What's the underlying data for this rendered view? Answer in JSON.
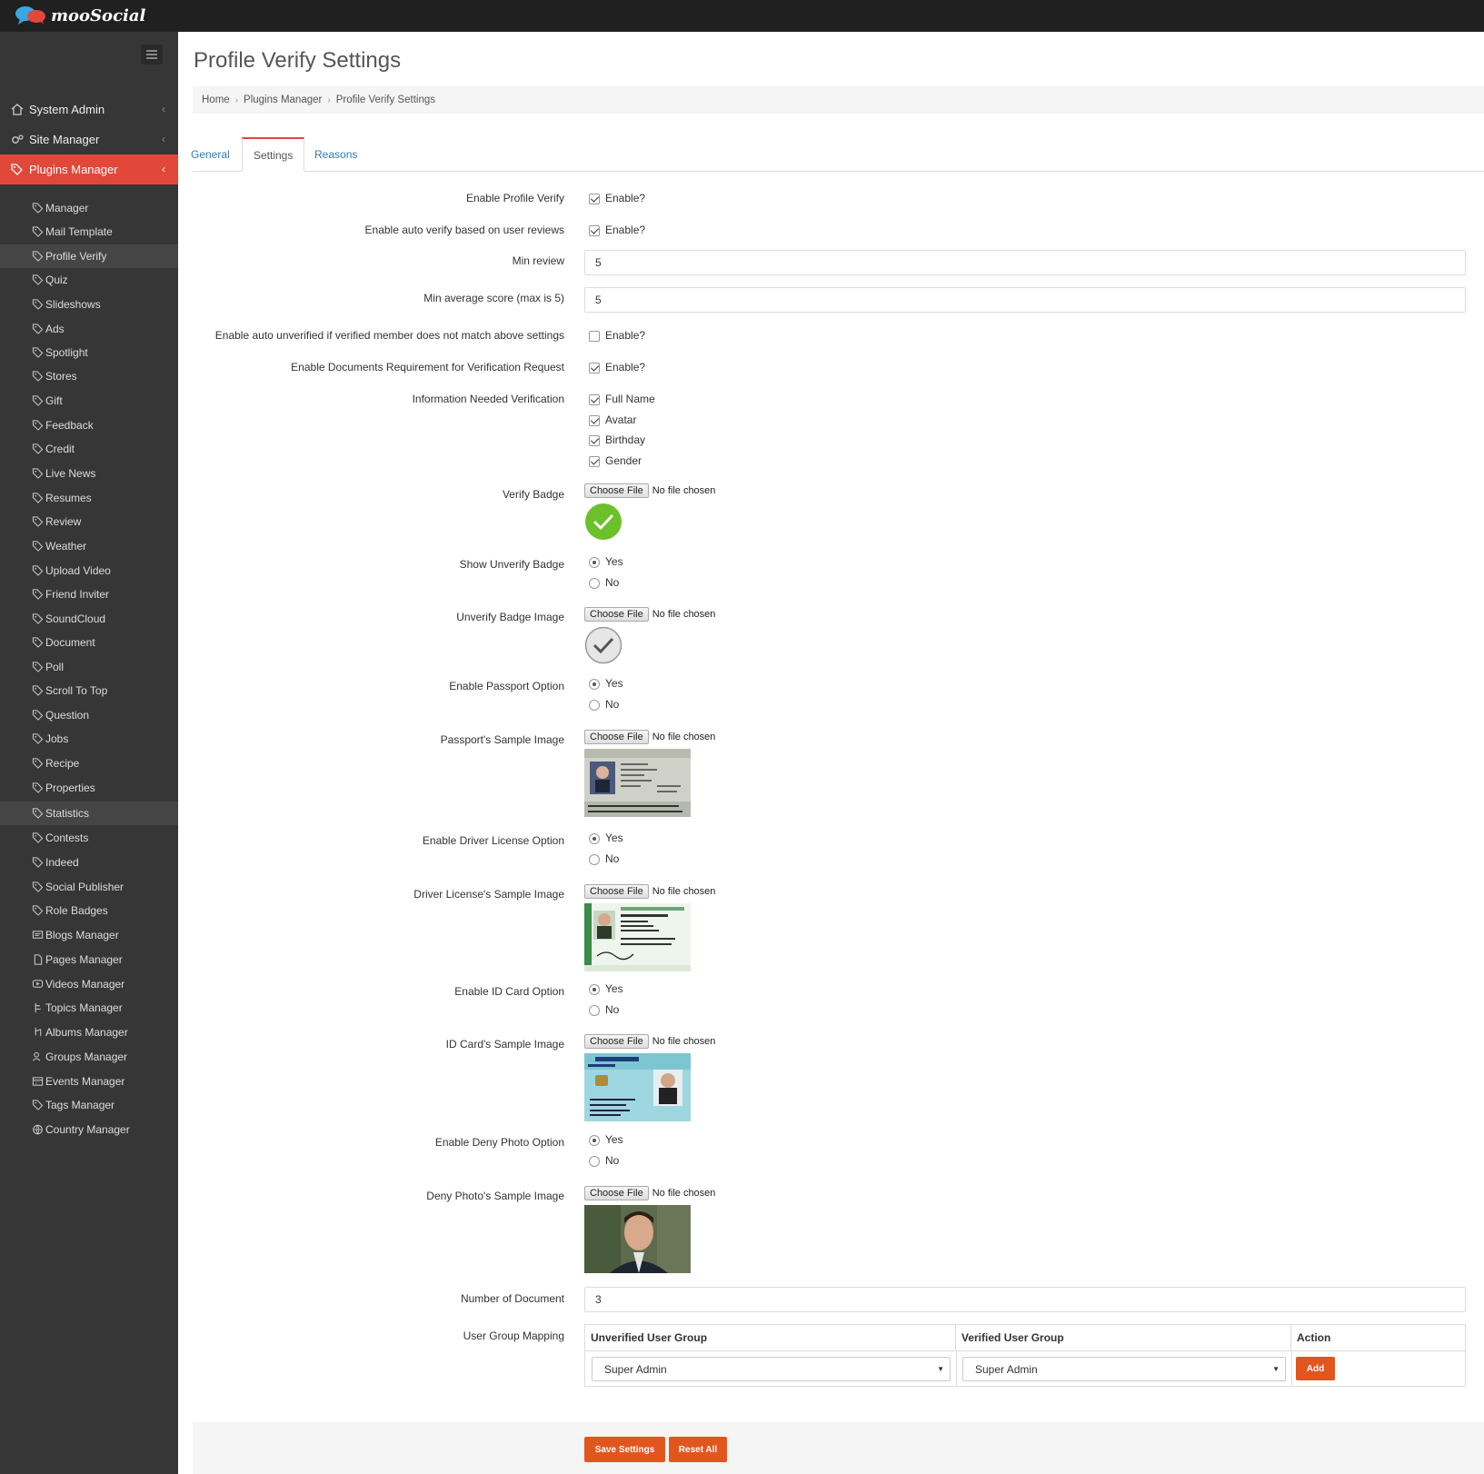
{
  "app": {
    "logo_text": "mooSocial"
  },
  "sidebar": {
    "sections": [
      {
        "label": "System Admin"
      },
      {
        "label": "Site Manager"
      },
      {
        "label": "Plugins Manager"
      }
    ],
    "items": [
      {
        "label": "Manager"
      },
      {
        "label": "Mail Template"
      },
      {
        "label": "Profile Verify"
      },
      {
        "label": "Quiz"
      },
      {
        "label": "Slideshows"
      },
      {
        "label": "Ads"
      },
      {
        "label": "Spotlight"
      },
      {
        "label": "Stores"
      },
      {
        "label": "Gift"
      },
      {
        "label": "Feedback"
      },
      {
        "label": "Credit"
      },
      {
        "label": "Live News"
      },
      {
        "label": "Resumes"
      },
      {
        "label": "Review"
      },
      {
        "label": "Weather"
      },
      {
        "label": "Upload Video"
      },
      {
        "label": "Friend Inviter"
      },
      {
        "label": "SoundCloud"
      },
      {
        "label": "Document"
      },
      {
        "label": "Poll"
      },
      {
        "label": "Scroll To Top"
      },
      {
        "label": "Question"
      },
      {
        "label": "Jobs"
      },
      {
        "label": "Recipe"
      },
      {
        "label": "Properties"
      },
      {
        "label": "Statistics"
      },
      {
        "label": "Contests"
      },
      {
        "label": "Indeed"
      },
      {
        "label": "Social Publisher"
      },
      {
        "label": "Role Badges"
      },
      {
        "label": "Blogs Manager"
      },
      {
        "label": "Pages Manager"
      },
      {
        "label": "Videos Manager"
      },
      {
        "label": "Topics Manager"
      },
      {
        "label": "Albums Manager"
      },
      {
        "label": "Groups Manager"
      },
      {
        "label": "Events Manager"
      },
      {
        "label": "Tags Manager"
      },
      {
        "label": "Country Manager"
      }
    ]
  },
  "page": {
    "title": "Profile Verify Settings"
  },
  "breadcrumb": [
    "Home",
    "Plugins Manager",
    "Profile Verify Settings"
  ],
  "tabs": [
    {
      "label": "General"
    },
    {
      "label": "Settings"
    },
    {
      "label": "Reasons"
    }
  ],
  "form": {
    "enable_profile_verify": {
      "label": "Enable Profile Verify",
      "option": "Enable?",
      "checked": true
    },
    "enable_auto_verify": {
      "label": "Enable auto verify based on user reviews",
      "option": "Enable?",
      "checked": true
    },
    "min_review": {
      "label": "Min review",
      "value": "5"
    },
    "min_avg_score": {
      "label": "Min average score (max is 5)",
      "value": "5"
    },
    "enable_auto_unverified": {
      "label": "Enable auto unverified if verified member does not match above settings",
      "option": "Enable?",
      "checked": false
    },
    "enable_documents": {
      "label": "Enable Documents Requirement for Verification Request",
      "option": "Enable?",
      "checked": true
    },
    "info_needed": {
      "label": "Information Needed Verification",
      "options": [
        {
          "label": "Full Name",
          "checked": true
        },
        {
          "label": "Avatar",
          "checked": true
        },
        {
          "label": "Birthday",
          "checked": true
        },
        {
          "label": "Gender",
          "checked": true
        }
      ]
    },
    "file_button": "Choose File",
    "file_status": "No file chosen",
    "verify_badge": {
      "label": "Verify Badge"
    },
    "show_unverify_badge": {
      "label": "Show Unverify Badge",
      "yes": "Yes",
      "no": "No",
      "selected": "Yes"
    },
    "unverify_badge_image": {
      "label": "Unverify Badge Image"
    },
    "enable_passport": {
      "label": "Enable Passport Option",
      "yes": "Yes",
      "no": "No",
      "selected": "Yes"
    },
    "passport_sample": {
      "label": "Passport's Sample Image"
    },
    "enable_driver_license": {
      "label": "Enable Driver License Option",
      "yes": "Yes",
      "no": "No",
      "selected": "Yes"
    },
    "driver_license_sample": {
      "label": "Driver License's Sample Image"
    },
    "enable_id_card": {
      "label": "Enable ID Card Option",
      "yes": "Yes",
      "no": "No",
      "selected": "Yes"
    },
    "id_card_sample": {
      "label": "ID Card's Sample Image"
    },
    "enable_deny_photo": {
      "label": "Enable Deny Photo Option",
      "yes": "Yes",
      "no": "No",
      "selected": "Yes"
    },
    "deny_photo_sample": {
      "label": "Deny Photo's Sample Image"
    },
    "number_of_document": {
      "label": "Number of Document",
      "value": "3"
    },
    "user_group_mapping": {
      "label": "User Group Mapping",
      "headers": [
        "Unverified User Group",
        "Verified User Group",
        "Action"
      ],
      "unverified_value": "Super Admin",
      "verified_value": "Super Admin",
      "add_label": "Add"
    }
  },
  "actions": {
    "save": "Save Settings",
    "reset": "Reset All"
  },
  "colors": {
    "accent": "#e1483a",
    "button": "#e1561f",
    "sidebar": "#363636",
    "topbar": "#202020",
    "link": "#337ab7"
  }
}
